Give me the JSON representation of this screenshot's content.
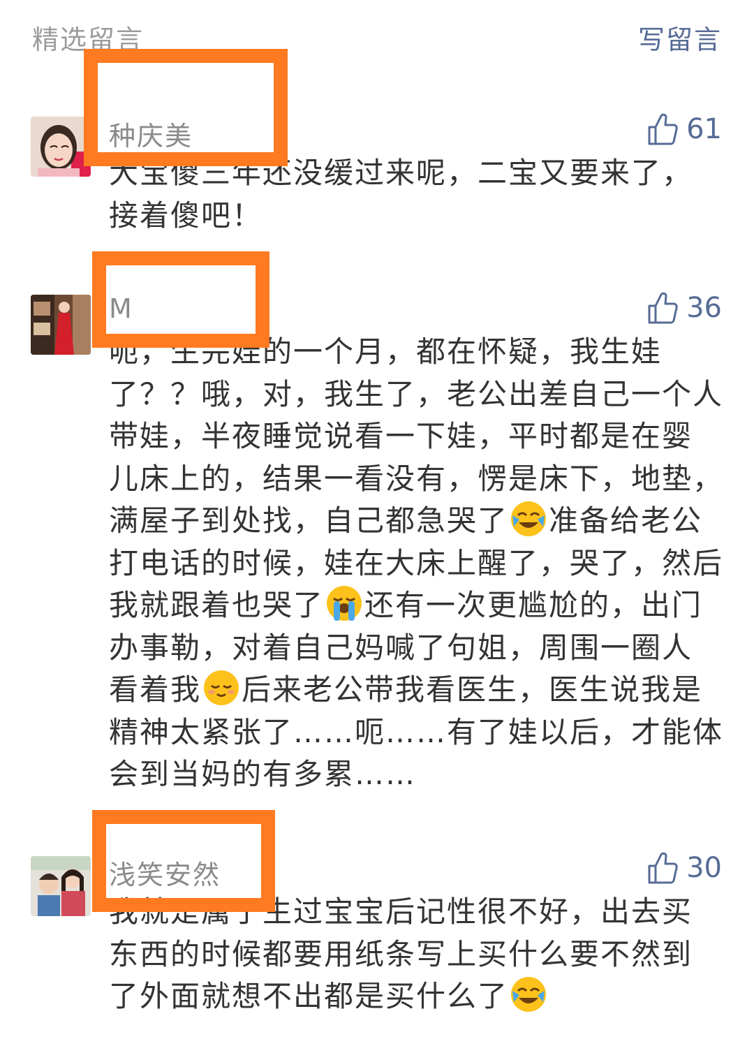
{
  "header": {
    "featured_label": "精选留言",
    "write_label": "写留言"
  },
  "comments": [
    {
      "nickname": "种庆美",
      "likes": "61",
      "text_parts": [
        "大宝傻三年还没缓过来呢，二宝又要来了，\n接着傻吧！"
      ],
      "avatar_icon": "avatar-photo-woman-red"
    },
    {
      "nickname": "M",
      "likes": "36",
      "text_a": "呃，生完娃的一个月，都在怀疑，我生娃\n了？？哦，对，我生了，老公出差自己一个人\n带娃，半夜睡觉说看一下娃，平时都是在婴\n儿床上的，结果一看没有，愣是床下，地垫，\n满屋子到处找，自己都急哭了",
      "text_b": "准备给老公\n打电话的时候，娃在大床上醒了，哭了，然后\n我就跟着也哭了",
      "text_c": "还有一次更尴尬的，出门\n办事勒，对着自己妈喊了句姐，周围一圈人\n看着我",
      "text_d": "后来老公带我看医生，医生说我是\n精神太紧张了……呃……有了娃以后，才能体\n会到当妈的有多累……",
      "avatar_icon": "avatar-photo-woman-red-dress"
    },
    {
      "nickname": "浅笑安然",
      "likes": "30",
      "text_a": "我就是属于生过宝宝后记性很不好，出去买\n东西的时候都要用纸条写上买什么要不然到\n了外面就想不出都是买什么了",
      "avatar_icon": "avatar-photo-mother-child"
    }
  ],
  "icons": {
    "thumb": "thumbs-up-icon",
    "emoji_cry_laugh": "face-with-tears-of-joy-icon",
    "emoji_sob": "loudly-crying-face-icon",
    "emoji_shy": "pensive-smile-icon"
  },
  "colors": {
    "link_blue": "#576b95",
    "redaction_orange": "#ff7a20",
    "text_dark": "#333333",
    "text_grey": "#8a8a8a"
  }
}
